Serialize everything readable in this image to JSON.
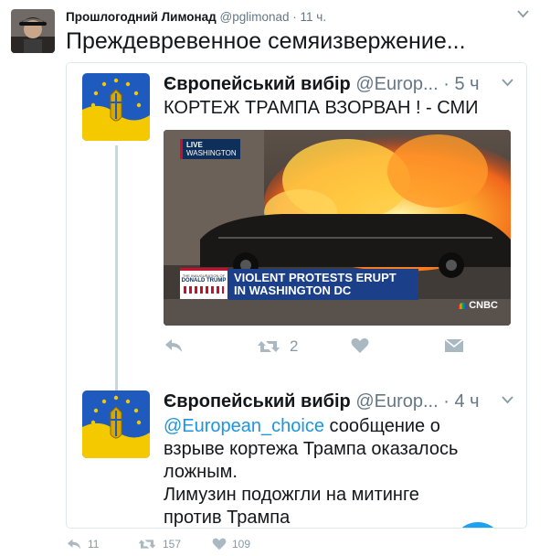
{
  "tweet": {
    "author_name": "Прошлогодний Лимонад",
    "author_handle": "@pglimonad",
    "separator": "·",
    "time": "11 ч.",
    "text": "Преждевревенное семяизвержение...",
    "stats": {
      "replies": "11",
      "retweets": "157",
      "likes": "109"
    }
  },
  "quoted": [
    {
      "author_name": "Європейський вибір",
      "author_handle": "@Europ...",
      "separator": "·",
      "time": "5 ч",
      "text": "КОРТЕЖ ТРАМПА ВЗОРВАН ! - СМИ",
      "retweet_count": "2",
      "media": {
        "live_line1": "LIVE",
        "live_line2": "WASHINGTON",
        "banner_small1": "THE INAUGURATION OF",
        "banner_small2": "DONALD TRUMP",
        "headline1": "VIOLENT PROTESTS ERUPT",
        "headline2": "IN WASHINGTON DC",
        "network": "CNBC"
      }
    },
    {
      "author_name": "Європейський вибір",
      "author_handle": "@Europ...",
      "separator": "·",
      "time": "4 ч",
      "mention": "@European_choice",
      "text_rest": " сообщение о взрыве кортежа Трампа оказалось ложным.",
      "text_line2": "Лимузин подожгли на митинге против Трампа"
    }
  ],
  "colors": {
    "link": "#1b95e0",
    "muted": "#8899a6",
    "border": "#e1e8ed"
  }
}
